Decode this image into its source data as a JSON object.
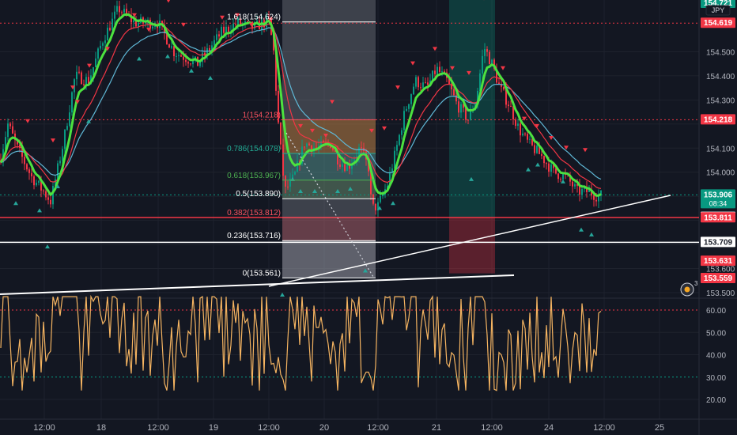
{
  "chart_data": {
    "type": "candlestick",
    "symbol_currency": "JPY",
    "price_axis": {
      "ylim": [
        153.48,
        154.73
      ],
      "ticks": [
        "154.500",
        "154.400",
        "154.300",
        "154.100",
        "154.000",
        "153.600",
        "153.500"
      ]
    },
    "time_axis": {
      "labels": [
        "12:00",
        "18",
        "12:00",
        "19",
        "12:00",
        "20",
        "12:00",
        "21",
        "12:00",
        "24",
        "12:00",
        "25"
      ]
    },
    "price_badges": [
      {
        "value": "154.721",
        "bg": "#089981",
        "fg": "#ffffff",
        "kind": "top"
      },
      {
        "value": "154.619",
        "bg": "#f23645",
        "fg": "#ffffff"
      },
      {
        "value": "154.218",
        "bg": "#f23645",
        "fg": "#ffffff"
      },
      {
        "value": "153.906",
        "bg": "#089981",
        "fg": "#ffffff",
        "countdown": "08:34"
      },
      {
        "value": "153.813",
        "bg": "#ffffff",
        "fg": "#131722"
      },
      {
        "value": "153.811",
        "bg": "#f23645",
        "fg": "#ffffff"
      },
      {
        "value": "153.709",
        "bg": "#ffffff",
        "fg": "#131722"
      },
      {
        "value": "153.631",
        "bg": "#f23645",
        "fg": "#ffffff"
      },
      {
        "value": "153.559",
        "bg": "#f23645",
        "fg": "#ffffff"
      }
    ],
    "horizontal_lines": [
      {
        "value": 154.619,
        "color": "#f23645",
        "style": "dotted"
      },
      {
        "value": 154.218,
        "color": "#f23645",
        "style": "dotted"
      },
      {
        "value": 153.906,
        "color": "#089981",
        "style": "dotted"
      },
      {
        "value": 153.812,
        "color": "#f23645",
        "style": "solid"
      },
      {
        "value": 153.709,
        "color": "#ffffff",
        "style": "solid"
      }
    ],
    "fibonacci": {
      "levels": [
        {
          "label": "1.618(154.624)",
          "color": "#ffffff",
          "value": 154.624
        },
        {
          "label": "1(154.218)",
          "color": "#f7525f",
          "value": 154.218
        },
        {
          "label": "0.786(154.078)",
          "color": "#22ab94",
          "value": 154.078
        },
        {
          "label": "0.618(153.967)",
          "color": "#4caf50",
          "value": 153.967
        },
        {
          "label": "0.5(153.890)",
          "color": "#ffffff",
          "value": 153.89
        },
        {
          "label": "0.382(153.812)",
          "color": "#f7525f",
          "value": 153.812
        },
        {
          "label": "0.236(153.716)",
          "color": "#ffffff",
          "value": 153.716
        },
        {
          "label": "0(153.561)",
          "color": "#ffffff",
          "value": 153.561
        }
      ]
    },
    "rsi": {
      "ylim": [
        15,
        67
      ],
      "ticks": [
        "60.00",
        "50.00",
        "40.00",
        "30.00",
        "20.00"
      ],
      "overbought": 60,
      "oversold": 30,
      "color": "#f5b461"
    },
    "alert_badge": "3",
    "colors": {
      "background": "#131722",
      "grid": "#1e222d",
      "up_candle": "#089981",
      "down_candle": "#f23645",
      "ma_fast": "#4ce23f",
      "ma_mid": "#f23645",
      "ma_slow": "#5fb8d6",
      "buy_marker": "#26a69a",
      "sell_marker": "#f23645"
    }
  }
}
